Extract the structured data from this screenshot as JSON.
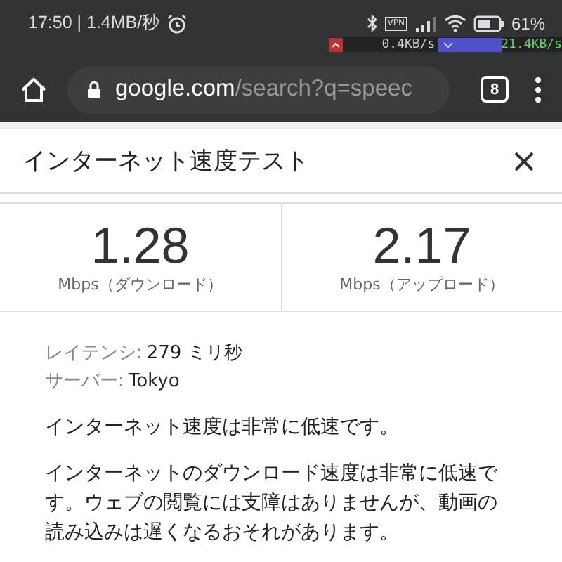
{
  "status_bar": {
    "time": "17:50 | 1.4MB/秒",
    "vpn": "VPN",
    "battery": "61%",
    "upload_speed": "0.4KB/s",
    "download_speed": "21.4KB/s"
  },
  "browser": {
    "url_host": "google.com",
    "url_path": "/search?q=speec",
    "tab_count": "8"
  },
  "card": {
    "title": "インターネット速度テスト",
    "stats": [
      {
        "value": "1.28",
        "label": "Mbps（ダウンロード）"
      },
      {
        "value": "2.17",
        "label": "Mbps（アップロード）"
      }
    ],
    "details": [
      {
        "label": "レイテンシ:",
        "value": "279 ミリ秒"
      },
      {
        "label": "サーバー:",
        "value": "Tokyo"
      }
    ],
    "summary": "インターネット速度は非常に低速です。",
    "description": "インターネットのダウンロード速度は非常に低速です。ウェブの閲覧には支障はありませんが、動画の読み込みは遅くなるおそれがあります。"
  }
}
